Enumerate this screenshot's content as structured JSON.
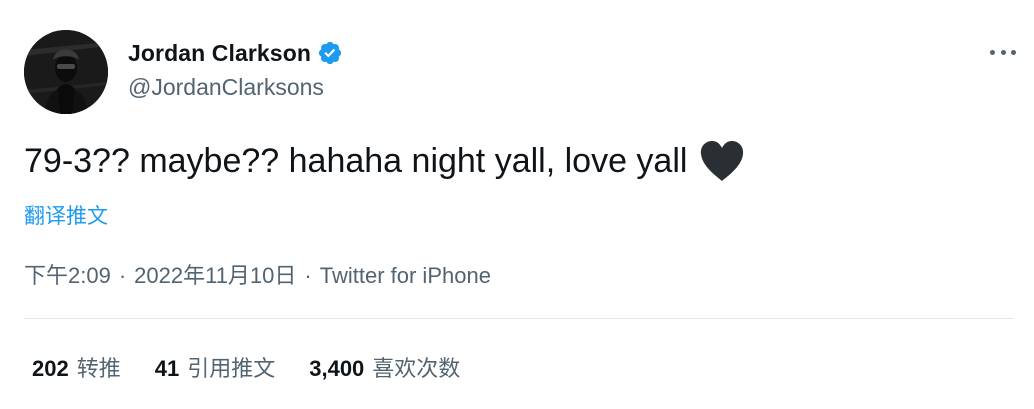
{
  "author": {
    "display_name": "Jordan Clarkson",
    "handle": "@JordanClarksons",
    "verified_icon": "verified-badge-icon",
    "avatar": "profile-photo"
  },
  "tweet": {
    "text": "79-3?? maybe?? hahaha night yall, love yall",
    "emoji": "black-heart-icon",
    "translate_label": "翻译推文"
  },
  "meta": {
    "time": "下午2:09",
    "separator": "·",
    "date": "2022年11月10日",
    "source": "Twitter for iPhone"
  },
  "stats": [
    {
      "count": "202",
      "label": "转推"
    },
    {
      "count": "41",
      "label": "引用推文"
    },
    {
      "count": "3,400",
      "label": "喜欢次数"
    }
  ],
  "colors": {
    "text": "#0f1419",
    "secondary": "#536471",
    "accent": "#1d9bf0",
    "divider": "#e3e6e8"
  }
}
